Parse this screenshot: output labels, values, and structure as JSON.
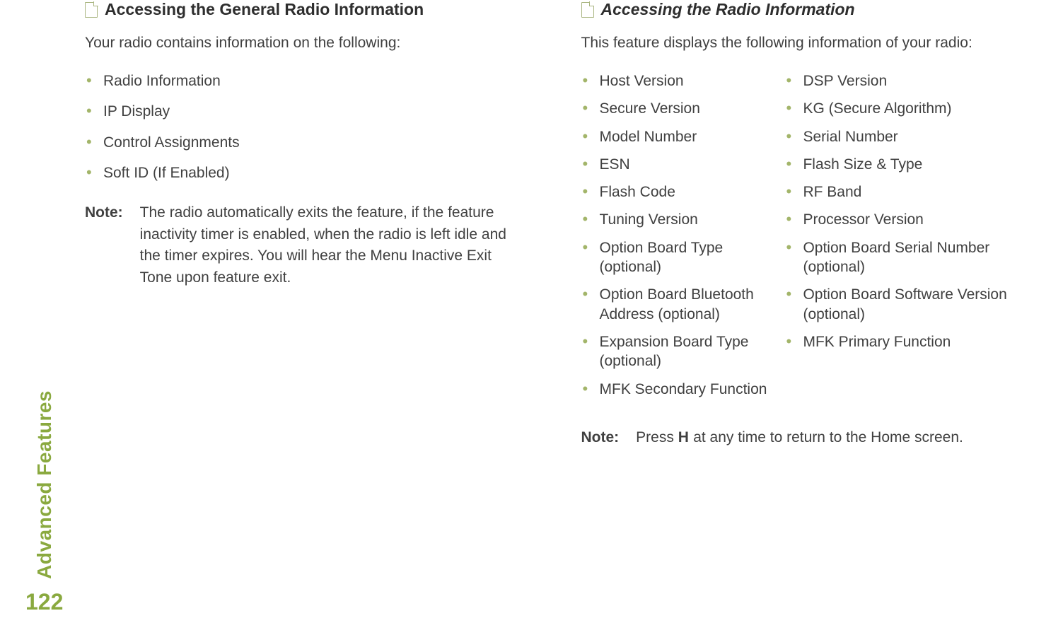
{
  "sidebar": {
    "section_label": "Advanced Features",
    "page_number": "122"
  },
  "left": {
    "heading": "Accessing the General Radio Information",
    "intro": "Your radio contains information on the following:",
    "items": [
      "Radio Information",
      "IP Display",
      "Control Assignments",
      "Soft ID (If Enabled)"
    ],
    "note_label": "Note:",
    "note_text": "The radio automatically exits the feature, if the feature inactivity timer is enabled, when the radio is left idle and the timer expires. You will hear the Menu Inactive Exit Tone upon feature exit."
  },
  "right": {
    "heading": "Accessing the Radio Information",
    "intro": "This feature displays the following information of your radio:",
    "items_col1": [
      "Host Version",
      "Secure Version",
      "Model Number",
      "ESN",
      "Flash Code",
      "Tuning Version",
      "Option Board Type (optional)",
      "Option Board Bluetooth Address (optional)",
      "Expansion Board Type (optional)",
      "MFK Secondary Function"
    ],
    "items_col2": [
      "DSP Version",
      "KG (Secure Algorithm)",
      "Serial Number",
      "Flash Size & Type",
      "RF Band",
      "Processor Version",
      "Option Board Serial Number (optional)",
      "Option Board Software Version (optional)",
      "MFK Primary Function"
    ],
    "note_label": "Note:",
    "note_prefix": "Press ",
    "note_key": "H",
    "note_suffix": " at any time to return to the Home screen."
  }
}
